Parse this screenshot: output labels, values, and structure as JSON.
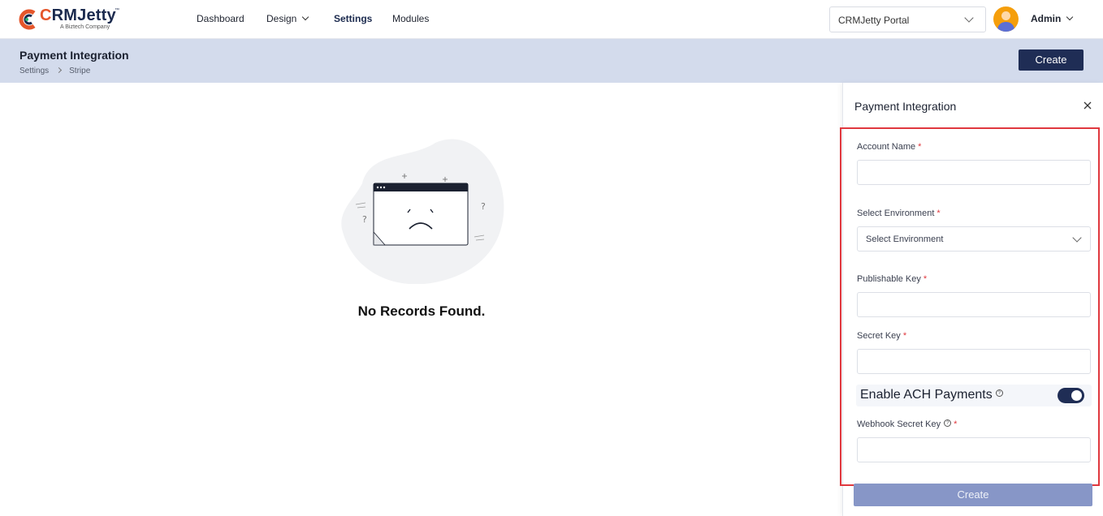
{
  "header": {
    "logo_word_c": "C",
    "logo_word_rest": "RMJetty",
    "logo_tm": "™",
    "logo_sub": "A Biztech Company",
    "nav": [
      "Dashboard",
      "Design",
      "Settings",
      "Modules"
    ],
    "portal_select": "CRMJetty Portal",
    "user": "Admin"
  },
  "band": {
    "title": "Payment Integration",
    "breadcrumb": [
      "Settings",
      "Stripe"
    ],
    "create_label": "Create"
  },
  "empty": {
    "message": "No Records Found."
  },
  "panel": {
    "title": "Payment Integration",
    "fields": {
      "account_name_label": "Account Name",
      "environment_label": "Select Environment",
      "environment_value": "Select Environment",
      "publishable_key_label": "Publishable Key",
      "secret_key_label": "Secret Key",
      "ach_label": "Enable ACH Payments",
      "ach_enabled": true,
      "webhook_label": "Webhook Secret Key",
      "required_mark": "*",
      "help_mark": "?"
    },
    "create_label": "Create"
  },
  "colors": {
    "brand_navy": "#1f2d55",
    "brand_orange": "#e5562b",
    "band_bg": "#d3dbec",
    "highlight": "#e0383e",
    "disabled_button": "#8796c7"
  }
}
